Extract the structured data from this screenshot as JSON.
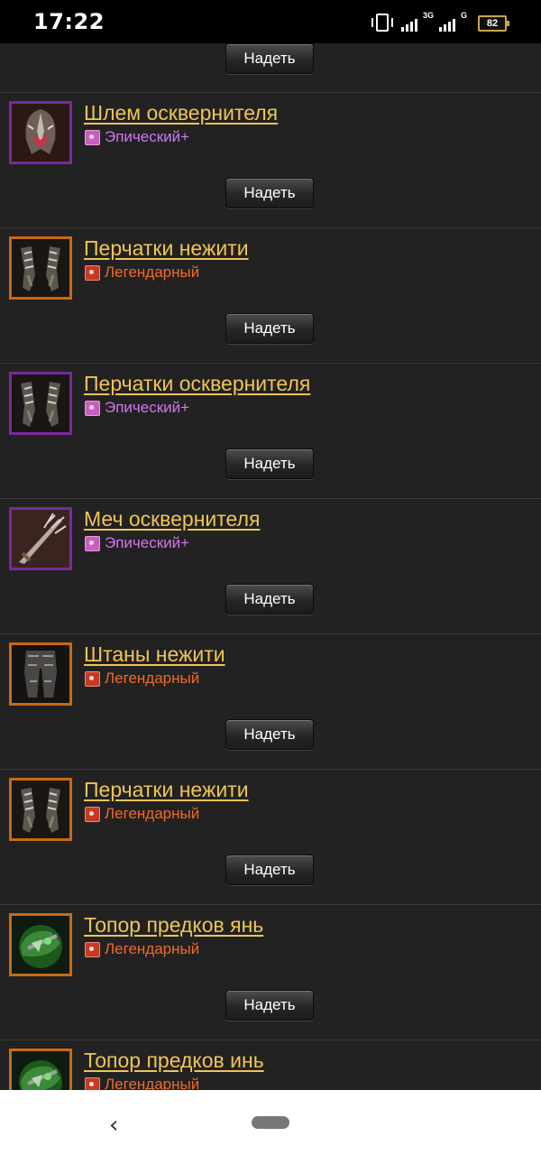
{
  "status_bar": {
    "time": "17:22",
    "network_1": "3G",
    "network_2": "G",
    "battery": "82"
  },
  "equip_label": "Надеть",
  "items": [
    {
      "name": "Шлем осквернителя",
      "rarity": "Эпический+",
      "rarity_type": "epic",
      "icon": "helmet-icon"
    },
    {
      "name": "Перчатки нежити",
      "rarity": "Легендарный",
      "rarity_type": "legendary",
      "icon": "gloves-icon"
    },
    {
      "name": "Перчатки осквернителя",
      "rarity": "Эпический+",
      "rarity_type": "epic",
      "icon": "gloves-icon"
    },
    {
      "name": "Меч осквернителя",
      "rarity": "Эпический+",
      "rarity_type": "epic",
      "icon": "sword-icon"
    },
    {
      "name": "Штаны нежити",
      "rarity": "Легендарный",
      "rarity_type": "legendary",
      "icon": "pants-icon"
    },
    {
      "name": "Перчатки нежити",
      "rarity": "Легендарный",
      "rarity_type": "legendary",
      "icon": "gloves-icon"
    },
    {
      "name": "Топор предков янь",
      "rarity": "Легендарный",
      "rarity_type": "legendary",
      "icon": "axe-icon"
    },
    {
      "name": "Топор предков инь",
      "rarity": "Легендарный",
      "rarity_type": "legendary",
      "icon": "axe-icon"
    }
  ],
  "colors": {
    "epic": "#d376f0",
    "legendary": "#f06a28",
    "item_name": "#f0c455",
    "background": "#222222"
  }
}
